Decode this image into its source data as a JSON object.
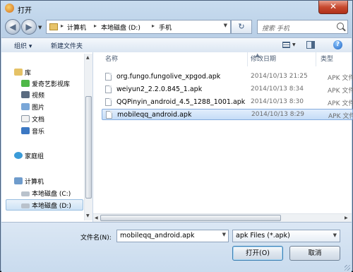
{
  "window": {
    "title": "打开",
    "close_symbol": "✕"
  },
  "nav": {
    "back_icon": "arrow-left-icon",
    "forward_icon": "arrow-right-icon",
    "breadcrumb": [
      "计算机",
      "本地磁盘 (D:)",
      "手机"
    ],
    "search_placeholder": "搜索 手机"
  },
  "toolbar": {
    "organize_label": "组织 ▾",
    "new_folder_label": "新建文件夹"
  },
  "sidebar": {
    "items": [
      {
        "label": "库",
        "icon": "library-icon"
      },
      {
        "label": "爱奇艺影视库",
        "icon": "video-library-icon"
      },
      {
        "label": "视频",
        "icon": "video-icon"
      },
      {
        "label": "图片",
        "icon": "picture-icon"
      },
      {
        "label": "文档",
        "icon": "document-icon"
      },
      {
        "label": "音乐",
        "icon": "music-icon"
      },
      {
        "label": "家庭组",
        "icon": "homegroup-icon"
      },
      {
        "label": "计算机",
        "icon": "computer-icon"
      },
      {
        "label": "本地磁盘 (C:)",
        "icon": "drive-icon"
      },
      {
        "label": "本地磁盘 (D:)",
        "icon": "drive-icon"
      }
    ],
    "selected": "本地磁盘 (D:)"
  },
  "columns": {
    "name": "名称",
    "modified": "修改日期",
    "type": "类型"
  },
  "files": [
    {
      "name": "org.fungo.fungolive_xpgod.apk",
      "modified": "2014/10/13 21:25",
      "type": "APK 文件"
    },
    {
      "name": "weiyun2_2.2.0.845_1.apk",
      "modified": "2014/10/13 8:34",
      "type": "APK 文件"
    },
    {
      "name": "QQPinyin_android_4.5_1288_1001.apk",
      "modified": "2014/10/13 8:30",
      "type": "APK 文件"
    },
    {
      "name": "mobileqq_android.apk",
      "modified": "2014/10/13 8:29",
      "type": "APK 文件"
    }
  ],
  "selected_file": "mobileqq_android.apk",
  "bottom": {
    "filename_label": "文件名(N):",
    "filename_value": "mobileqq_android.apk",
    "filter_value": "apk Files (*.apk)",
    "open_label": "打开(O)",
    "cancel_label": "取消"
  },
  "colors": {
    "selection": "#c4dcf7",
    "selection_border": "#84acdd",
    "chrome": "#b7cde5",
    "close_button": "#c74a2f"
  }
}
